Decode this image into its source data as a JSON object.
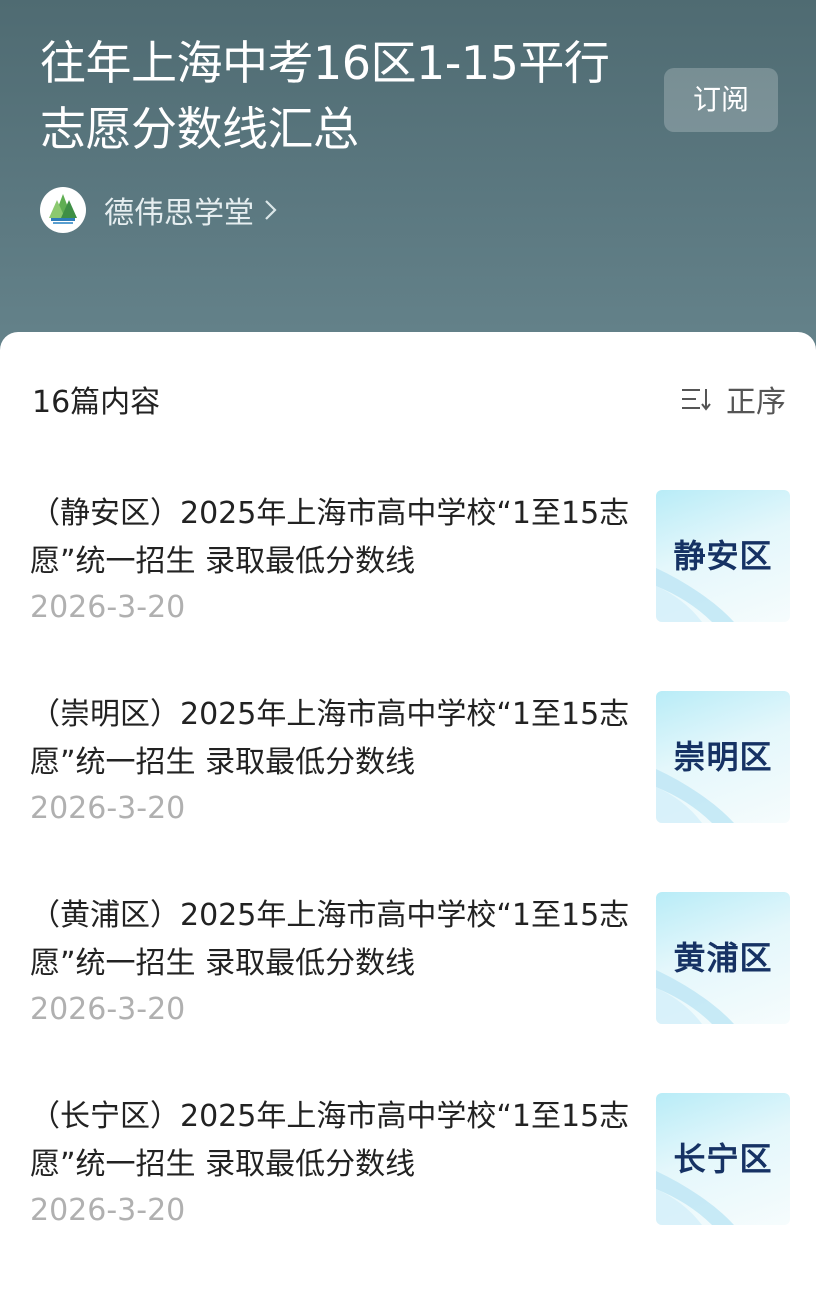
{
  "header": {
    "title": "往年上海中考16区1-15平行志愿分数线汇总",
    "subscribe_label": "订阅",
    "author_name": "德伟思学堂",
    "avatar_icon": "school-logo-icon",
    "chevron_icon": "chevron-right-icon"
  },
  "list": {
    "count_label": "16篇内容",
    "sort_label": "正序",
    "sort_icon": "sort-list-icon",
    "items": [
      {
        "title": "（静安区）2025年上海市高中学校“1至15志愿”统一招生 录取最低分数线",
        "date": "2026-3-20",
        "thumb_label": "静安区"
      },
      {
        "title": "（崇明区）2025年上海市高中学校“1至15志愿”统一招生 录取最低分数线",
        "date": "2026-3-20",
        "thumb_label": "崇明区"
      },
      {
        "title": "（黄浦区）2025年上海市高中学校“1至15志愿”统一招生 录取最低分数线",
        "date": "2026-3-20",
        "thumb_label": "黄浦区"
      },
      {
        "title": "（长宁区）2025年上海市高中学校“1至15志愿”统一招生 录取最低分数线",
        "date": "2026-3-20",
        "thumb_label": "长宁区"
      }
    ]
  },
  "colors": {
    "header_bg": "#5b7880",
    "thumb_text": "#163264",
    "date_text": "#b0b0b0"
  }
}
